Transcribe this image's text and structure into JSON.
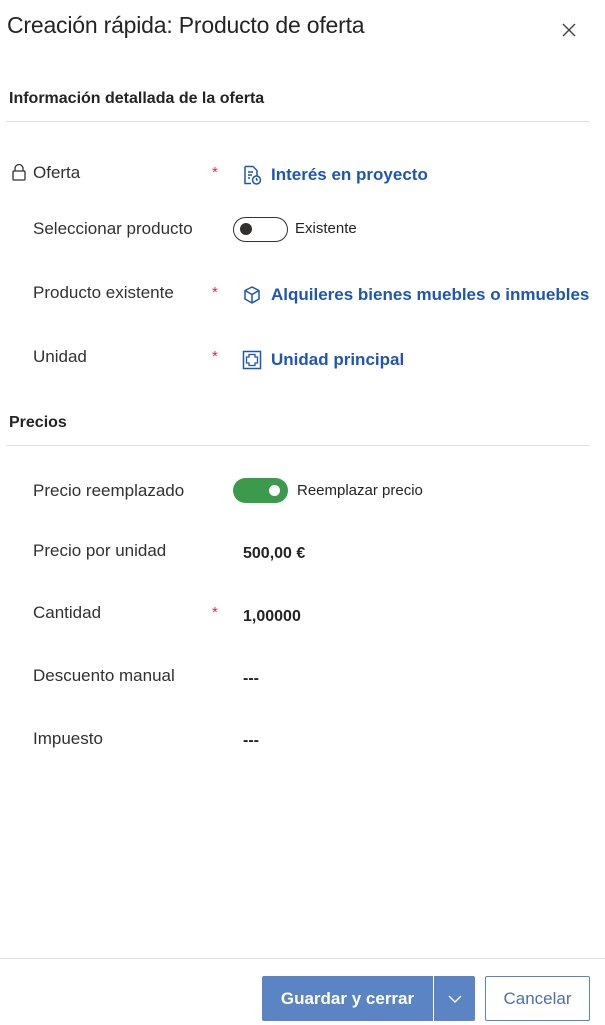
{
  "header": {
    "title": "Creación rápida: Producto de oferta",
    "close_icon": "close-icon"
  },
  "section_details": {
    "title": "Información detallada de la oferta",
    "fields": {
      "oferta": {
        "label": "Oferta",
        "required": "*",
        "value": "Interés en proyecto",
        "icon": "quote-document-icon",
        "locked": true
      },
      "seleccionar_producto": {
        "label": "Seleccionar producto",
        "toggle_on": false,
        "toggle_text": "Existente"
      },
      "producto_existente": {
        "label": "Producto existente",
        "required": "*",
        "value": "Alquileres bienes muebles o inmuebles",
        "icon": "product-cube-icon"
      },
      "unidad": {
        "label": "Unidad",
        "required": "*",
        "value": "Unidad principal",
        "icon": "unit-icon"
      }
    }
  },
  "section_pricing": {
    "title": "Precios",
    "fields": {
      "precio_reemplazado": {
        "label": "Precio reemplazado",
        "toggle_on": true,
        "toggle_text": "Reemplazar precio"
      },
      "precio_por_unidad": {
        "label": "Precio por unidad",
        "value": "500,00 €"
      },
      "cantidad": {
        "label": "Cantidad",
        "required": "*",
        "value": "1,00000"
      },
      "descuento_manual": {
        "label": "Descuento manual",
        "value": "---"
      },
      "impuesto": {
        "label": "Impuesto",
        "value": "---"
      }
    }
  },
  "footer": {
    "save_close_label": "Guardar y cerrar",
    "cancel_label": "Cancelar",
    "split_icon": "chevron-down-icon"
  },
  "colors": {
    "link": "#1f56b4",
    "required": "#c4314b",
    "toggle_on": "#3c9a4d",
    "primary_button": "#5b84c4"
  }
}
